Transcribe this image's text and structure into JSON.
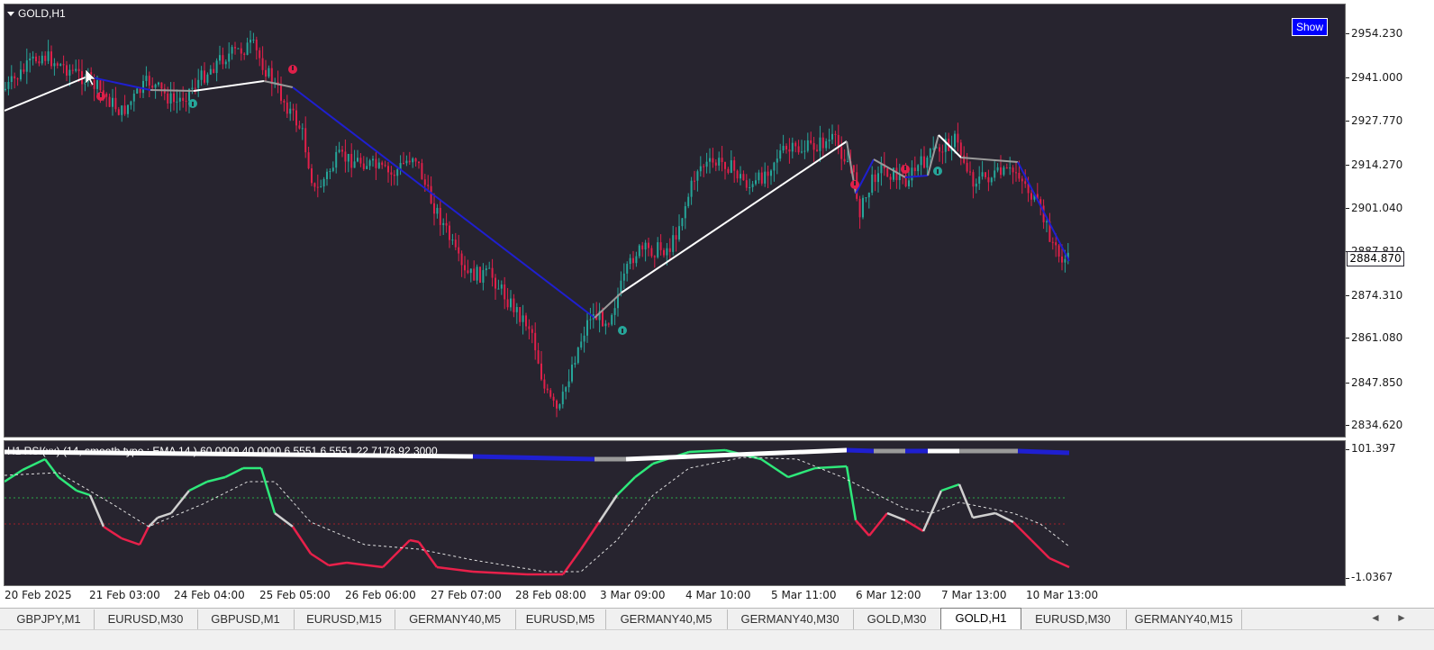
{
  "window": {
    "symbol_title": "GOLD,H1",
    "show_button": "Show"
  },
  "price_axis": {
    "labels": [
      "2954.230",
      "2941.000",
      "2927.770",
      "2914.270",
      "2901.040",
      "2887.810",
      "2874.310",
      "2861.080",
      "2847.850",
      "2834.620"
    ],
    "current_price": "2884.870"
  },
  "indicator": {
    "label": "H1 RSI(xx) (14, smooth type : EMA 14 ) 60.0000 40.0000 6.5551 6.5551 22.7178 92.3000",
    "axis_top": "101.397",
    "axis_bottom": "-1.0367"
  },
  "time_axis": {
    "labels": [
      "20 Feb 2025",
      "21 Feb 03:00",
      "24 Feb 04:00",
      "25 Feb 05:00",
      "26 Feb 06:00",
      "27 Feb 07:00",
      "28 Feb 08:00",
      "3 Mar 09:00",
      "4 Mar 10:00",
      "5 Mar 11:00",
      "6 Mar 12:00",
      "7 Mar 13:00",
      "10 Mar 13:00"
    ]
  },
  "tabs": [
    "GBPJPY,M1",
    "EURUSD,M30",
    "GBPUSD,M1",
    "EURUSD,M15",
    "GERMANY40,M5",
    "EURUSD,M5",
    "GERMANY40,M5",
    "GERMANY40,M30",
    "GOLD,M30",
    "GOLD,H1",
    "EURUSD,M30",
    "GERMANY40,M15"
  ],
  "active_tab": "GOLD,H1",
  "colors": {
    "background": "#27242f",
    "bull_candle": "#26a69a",
    "bear_candle": "#e0204a",
    "zigzag_up": "#ffffff",
    "zigzag_down": "#1f1fd0",
    "zigzag_flat": "#9a9a9a",
    "rsi_high": "#2ee87a",
    "rsi_low": "#e8204a",
    "rsi_mid": "#d0d0d0"
  },
  "icons": [
    "chevron-left-icon",
    "chevron-right-icon",
    "signal-up-icon",
    "signal-down-icon"
  ]
}
